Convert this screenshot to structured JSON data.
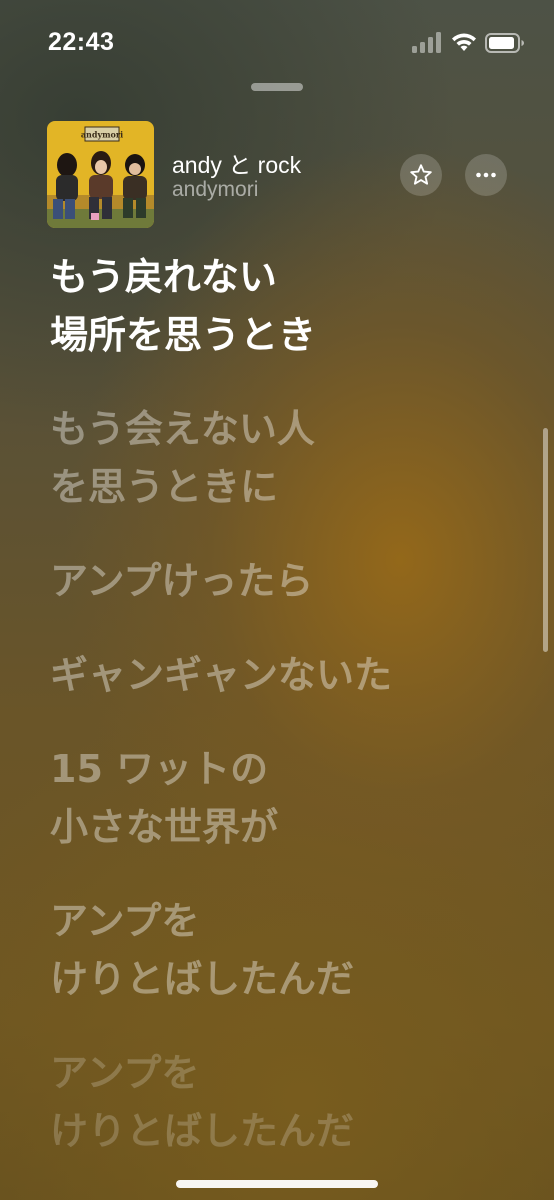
{
  "status_bar": {
    "time": "22:43",
    "icons": [
      "cellular-signal-icon",
      "wifi-icon",
      "battery-icon"
    ]
  },
  "now_playing": {
    "album_logo_text": "andymori",
    "title": "andy と rock",
    "artist": "andymori",
    "buttons": [
      "star-icon",
      "more-icon"
    ]
  },
  "lyrics": [
    {
      "lines": [
        "もう戻れない",
        "場所を思うとき"
      ],
      "state": "active"
    },
    {
      "lines": [
        "もう会えない人",
        "を思うときに"
      ],
      "state": "upcoming"
    },
    {
      "lines": [
        "アンプけったら"
      ],
      "state": "upcoming"
    },
    {
      "lines": [
        "ギャンギャンないた"
      ],
      "state": "upcoming"
    },
    {
      "lines": [
        "15 ワットの",
        "小さな世界が"
      ],
      "state": "upcoming"
    },
    {
      "lines": [
        "アンプを",
        "けりとばしたんだ"
      ],
      "state": "upcoming"
    },
    {
      "lines": [
        "アンプを",
        "けりとばしたんだ"
      ],
      "state": "fade"
    }
  ],
  "colors": {
    "active_lyric": "#ffffff",
    "background_warm": "#6e5622",
    "background_cool": "#4d5246"
  }
}
